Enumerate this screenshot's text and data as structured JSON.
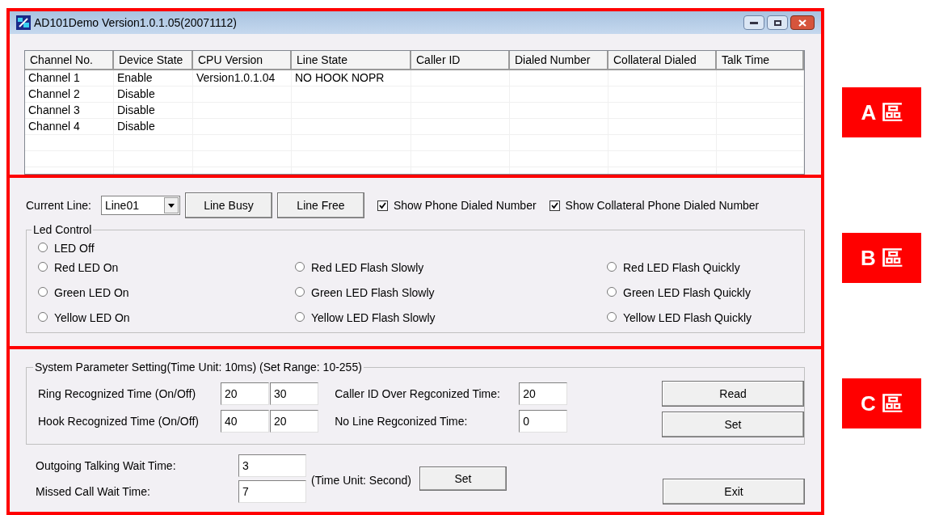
{
  "window": {
    "title": "AD101Demo Version1.0.1.05(20071112)"
  },
  "table": {
    "columns": [
      "Channel No.",
      "Device State",
      "CPU Version",
      "Line State",
      "Caller ID",
      "Dialed Number",
      "Collateral Dialed",
      "Talk Time"
    ],
    "rows": [
      {
        "cells": [
          "Channel 1",
          "Enable",
          "Version1.0.1.04",
          "NO HOOK NOPR"
        ]
      },
      {
        "cells": [
          "Channel 2",
          "Disable"
        ]
      },
      {
        "cells": [
          "Channel 3",
          "Disable"
        ]
      },
      {
        "cells": [
          "Channel 4",
          "Disable"
        ]
      }
    ]
  },
  "line_controls": {
    "label": "Current Line:",
    "line_value": "Line01",
    "buttons": [
      "Line Busy",
      "Line Free"
    ],
    "checkboxes": [
      {
        "label": "Show Phone Dialed Number",
        "checked": true
      },
      {
        "label": "Show Collateral Phone Dialed Number",
        "checked": true
      }
    ]
  },
  "led_control": {
    "title": "Led Control",
    "rows": [
      [
        {
          "label": "LED Off",
          "selected": false
        }
      ],
      [
        {
          "label": "Red LED On",
          "selected": false
        },
        {
          "label": "Red LED Flash Slowly",
          "selected": false
        },
        {
          "label": "Red LED Flash Quickly",
          "selected": false
        }
      ],
      [
        {
          "label": "Green LED On",
          "selected": false
        },
        {
          "label": "Green LED Flash Slowly",
          "selected": false
        },
        {
          "label": "Green LED Flash Quickly",
          "selected": false
        }
      ],
      [
        {
          "label": "Yellow LED On",
          "selected": false
        },
        {
          "label": "Yellow LED Flash Slowly",
          "selected": false
        },
        {
          "label": "Yellow LED Flash Quickly",
          "selected": false
        }
      ]
    ]
  },
  "system_parameters": {
    "title": "System Parameter Setting(Time Unit: 10ms) (Set Range: 10-255)",
    "left_fields": [
      {
        "label": "Ring Recognized Time (On/Off)",
        "values": [
          "20",
          "30"
        ]
      },
      {
        "label": "Hook Recognized Time (On/Off)",
        "values": [
          "40",
          "20"
        ]
      }
    ],
    "right_fields": [
      {
        "label": "Caller ID Over Regconized Time:",
        "value": "20"
      },
      {
        "label": "No Line Regconized Time:",
        "value": "0"
      }
    ],
    "buttons": [
      "Read",
      "Set"
    ]
  },
  "wait_times": {
    "fields": [
      {
        "label": "Outgoing Talking Wait Time:",
        "value": "3"
      },
      {
        "label": "Missed Call Wait Time:",
        "value": "7"
      }
    ],
    "unit_note": "(Time Unit: Second)",
    "set_button": "Set",
    "exit_button": "Exit"
  },
  "region_labels": [
    "A 區",
    "B 區",
    "C 區"
  ]
}
